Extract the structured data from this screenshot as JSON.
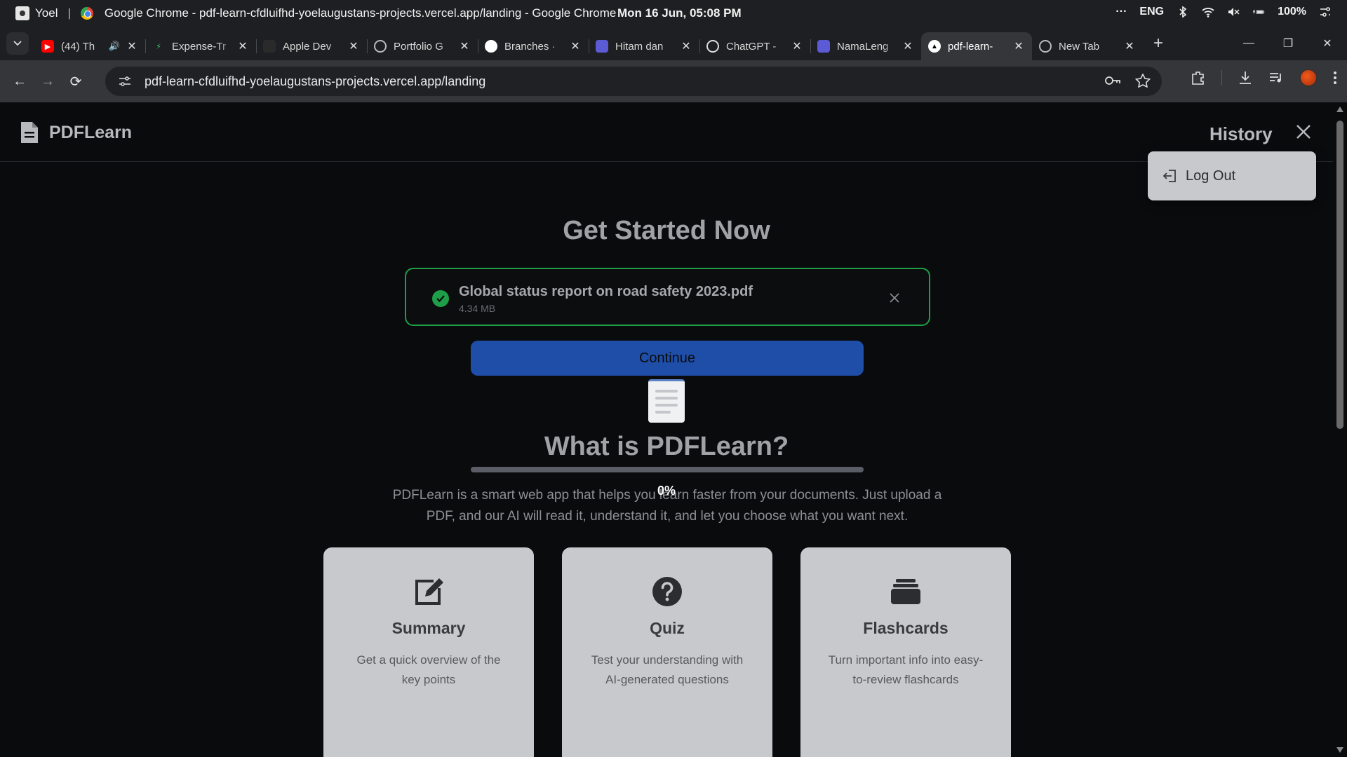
{
  "os": {
    "user": "Yoel",
    "window_title": "Google Chrome  -  pdf-learn-cfdluifhd-yoelaugustans-projects.vercel.app/landing - Google Chrome",
    "clock": "Mon 16 Jun, 05:08 PM",
    "tray": {
      "overflow": "···",
      "lang": "ENG",
      "battery": "100%"
    }
  },
  "browser": {
    "tabs": [
      {
        "label": "(44) Th",
        "icon": "youtube-icon",
        "color": "#ff0000",
        "audio": true
      },
      {
        "label": "Expense-Tr",
        "icon": "bolt-icon",
        "color": "#2ecc71"
      },
      {
        "label": "Apple Dev",
        "icon": "apple-dev-icon",
        "color": "#2a2a2a"
      },
      {
        "label": "Portfolio G",
        "icon": "globe-icon",
        "color": "#5f6368"
      },
      {
        "label": "Branches ·",
        "icon": "github-icon",
        "color": "#24292e"
      },
      {
        "label": "Hitam dan",
        "icon": "site-icon",
        "color": "#5b5bd6"
      },
      {
        "label": "ChatGPT -",
        "icon": "chatgpt-icon",
        "color": "#3a3a3a"
      },
      {
        "label": "NamaLeng",
        "icon": "site-icon",
        "color": "#5b5bd6"
      },
      {
        "label": "pdf-learn-",
        "icon": "vercel-icon",
        "color": "#000000",
        "active": true
      },
      {
        "label": "New Tab",
        "icon": "chrome-icon",
        "color": "#5f6368"
      }
    ],
    "url": "pdf-learn-cfdluifhd-yoelaugustans-projects.vercel.app/landing"
  },
  "app": {
    "brand": "PDFLearn",
    "history_label": "History",
    "menu": {
      "logout_label": "Log Out"
    },
    "hero_title": "Get Started Now",
    "file": {
      "name": "Global status report on road safety 2023.pdf",
      "size": "4.34 MB"
    },
    "continue_label": "Continue",
    "what_title": "What is PDFLearn?",
    "progress": {
      "value": 0,
      "label": "0%"
    },
    "intro": "PDFLearn is a smart web app that helps you learn faster from your documents. Just upload a PDF, and our AI will read it, understand it, and let you choose what you want next.",
    "features": [
      {
        "icon": "edit-icon",
        "title": "Summary",
        "desc": "Get a quick overview of the key points"
      },
      {
        "icon": "question-icon",
        "title": "Quiz",
        "desc": "Test your understanding with AI-generated questions"
      },
      {
        "icon": "cards-icon",
        "title": "Flashcards",
        "desc": "Turn important info into easy-to-review flashcards"
      }
    ],
    "colors": {
      "accent": "#1e4ea8",
      "success": "#1e9e46"
    }
  }
}
